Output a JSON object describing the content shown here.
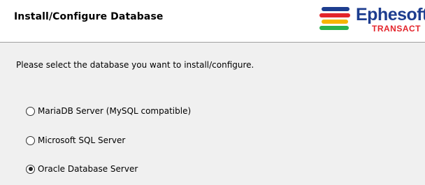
{
  "header": {
    "title": "Install/Configure Database"
  },
  "logo": {
    "name": "Ephesoft",
    "tagline": "TRANSACT",
    "colors": {
      "name": "#1d3d8f",
      "tagline": "#e3242b",
      "stripes": [
        "#1d3d8f",
        "#e3242b",
        "#f7b500",
        "#2bb24c"
      ]
    }
  },
  "content": {
    "prompt": "Please select the database you want to install/configure.",
    "options": [
      {
        "label": "MariaDB Server (MySQL compatible)",
        "checked": false
      },
      {
        "label": "Microsoft SQL Server",
        "checked": false
      },
      {
        "label": "Oracle Database Server",
        "checked": true
      }
    ]
  }
}
